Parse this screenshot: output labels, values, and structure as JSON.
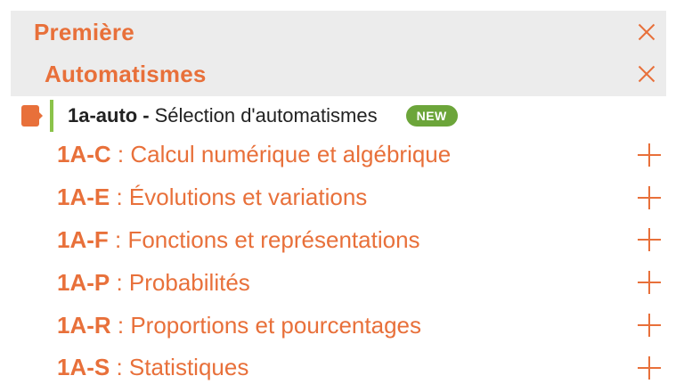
{
  "levels": {
    "level1": {
      "title": "Première"
    },
    "level2": {
      "title": "Automatismes"
    }
  },
  "automatism": {
    "code": "1a-auto",
    "separator": "-",
    "title": "Sélection d'automatismes",
    "badge": "NEW"
  },
  "topics": [
    {
      "code": "1A-C",
      "label": " : Calcul numérique et algébrique"
    },
    {
      "code": "1A-E",
      "label": " : Évolutions et variations"
    },
    {
      "code": "1A-F",
      "label": " : Fonctions et représentations"
    },
    {
      "code": "1A-P",
      "label": " : Probabilités"
    },
    {
      "code": "1A-R",
      "label": " : Proportions et pourcentages"
    },
    {
      "code": "1A-S",
      "label": " : Statistiques"
    }
  ],
  "colors": {
    "accent": "#e8703a",
    "header_bg": "#ececec",
    "badge_green": "#6ca53a",
    "bar_green": "#8bc34a"
  },
  "icons": {
    "close": "close-icon",
    "expand": "plus-icon",
    "tag": "tag-icon"
  }
}
